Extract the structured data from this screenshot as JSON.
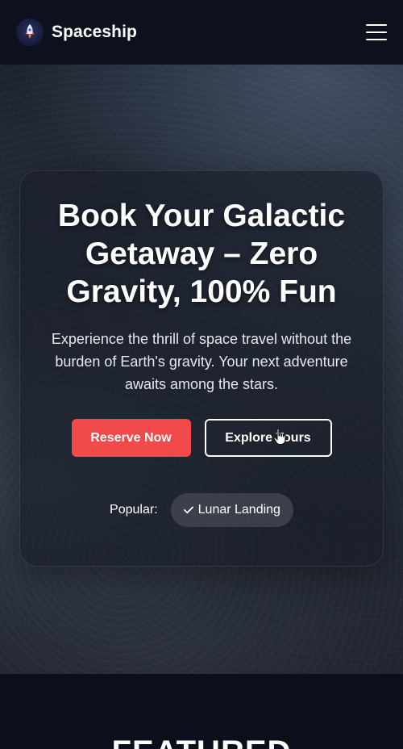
{
  "brand": {
    "name": "Spaceship",
    "logo_icon": "rocket-icon"
  },
  "header": {
    "menu_icon": "hamburger-menu-icon"
  },
  "hero": {
    "title": "Book Your Galactic Getaway – Zero Gravity, 100% Fun",
    "subtitle": "Experience the thrill of space travel without the burden of Earth's gravity. Your next adventure awaits among the stars.",
    "primary_button": "Reserve Now",
    "secondary_button": "Explore Tours",
    "popular_label": "Popular:",
    "popular_chips": [
      {
        "label": "Lunar Landing",
        "icon": "check-icon"
      }
    ]
  },
  "featured": {
    "heading": "FEATURED"
  },
  "colors": {
    "accent": "#f24a4a",
    "background": "#0b0f1c"
  }
}
